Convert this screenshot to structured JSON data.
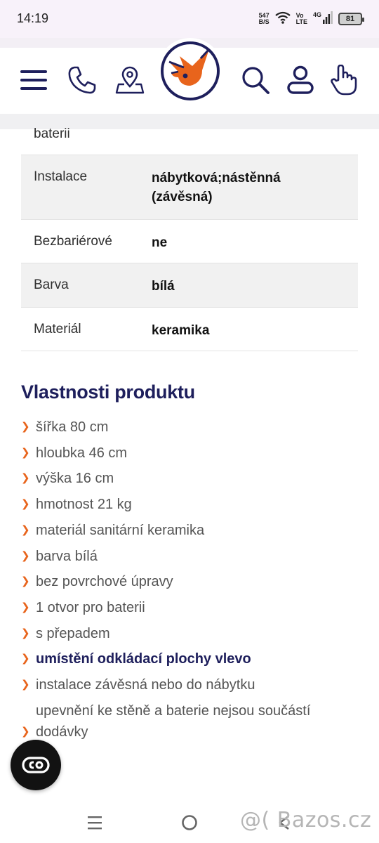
{
  "status_bar": {
    "time": "14:19",
    "net_speed_value": "547",
    "net_speed_unit": "B/S",
    "volte_top": "Vo",
    "volte_bottom": "LTE",
    "network": "4G",
    "battery": "81"
  },
  "header": {
    "icons": [
      "menu-icon",
      "phone-icon",
      "location-pin-icon",
      "search-icon",
      "user-icon",
      "hand-pointer-icon"
    ],
    "logo": "bird-logo"
  },
  "param_table": {
    "rows": [
      {
        "key": "baterii",
        "value": ""
      },
      {
        "key": "Instalace",
        "value": "nábytková;nástěnná (závěsná)"
      },
      {
        "key": "Bezbariérové",
        "value": "ne"
      },
      {
        "key": "Barva",
        "value": "bílá"
      },
      {
        "key": "Materiál",
        "value": "keramika"
      }
    ]
  },
  "properties": {
    "title": "Vlastnosti produktu",
    "bullet": "❯",
    "items": [
      "šířka 80 cm",
      "hloubka 46 cm",
      "výška 16 cm",
      "hmotnost 21 kg",
      "materiál sanitární keramika",
      "barva bílá",
      "bez povrchové úpravy",
      "1 otvor pro baterii",
      "s přepadem",
      "umístění odkládací plochy vlevo",
      "instalace závěsná nebo do nábytku",
      "upevnění ke stěně a baterie nejsou součástí dodávky"
    ],
    "highlighted_index": 9
  },
  "fab": {
    "icon": "co-logo-icon"
  },
  "nav_bar": {
    "buttons": [
      "recent-apps-icon",
      "home-icon",
      "back-icon"
    ],
    "watermark": "@( Bazos.cz"
  },
  "colors": {
    "brand_navy": "#1e1f5c",
    "brand_orange": "#e8641c",
    "row_alt": "#f1f1f1"
  }
}
